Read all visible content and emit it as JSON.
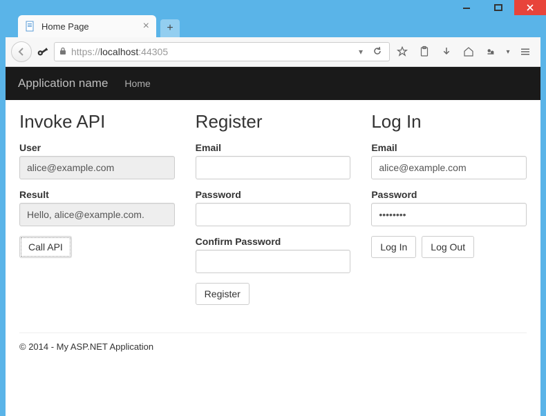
{
  "window": {
    "tab_title": "Home Page"
  },
  "url": {
    "scheme": "https://",
    "host": "localhost",
    "port": ":44305"
  },
  "navbar": {
    "brand": "Application name",
    "home": "Home"
  },
  "invoke": {
    "heading": "Invoke API",
    "user_label": "User",
    "user_value": "alice@example.com",
    "result_label": "Result",
    "result_value": "Hello, alice@example.com.",
    "button": "Call API"
  },
  "register": {
    "heading": "Register",
    "email_label": "Email",
    "email_value": "",
    "password_label": "Password",
    "password_value": "",
    "confirm_label": "Confirm Password",
    "confirm_value": "",
    "button": "Register"
  },
  "login": {
    "heading": "Log In",
    "email_label": "Email",
    "email_value": "alice@example.com",
    "password_label": "Password",
    "password_value": "••••••••",
    "login_button": "Log In",
    "logout_button": "Log Out"
  },
  "footer": "© 2014 - My ASP.NET Application"
}
